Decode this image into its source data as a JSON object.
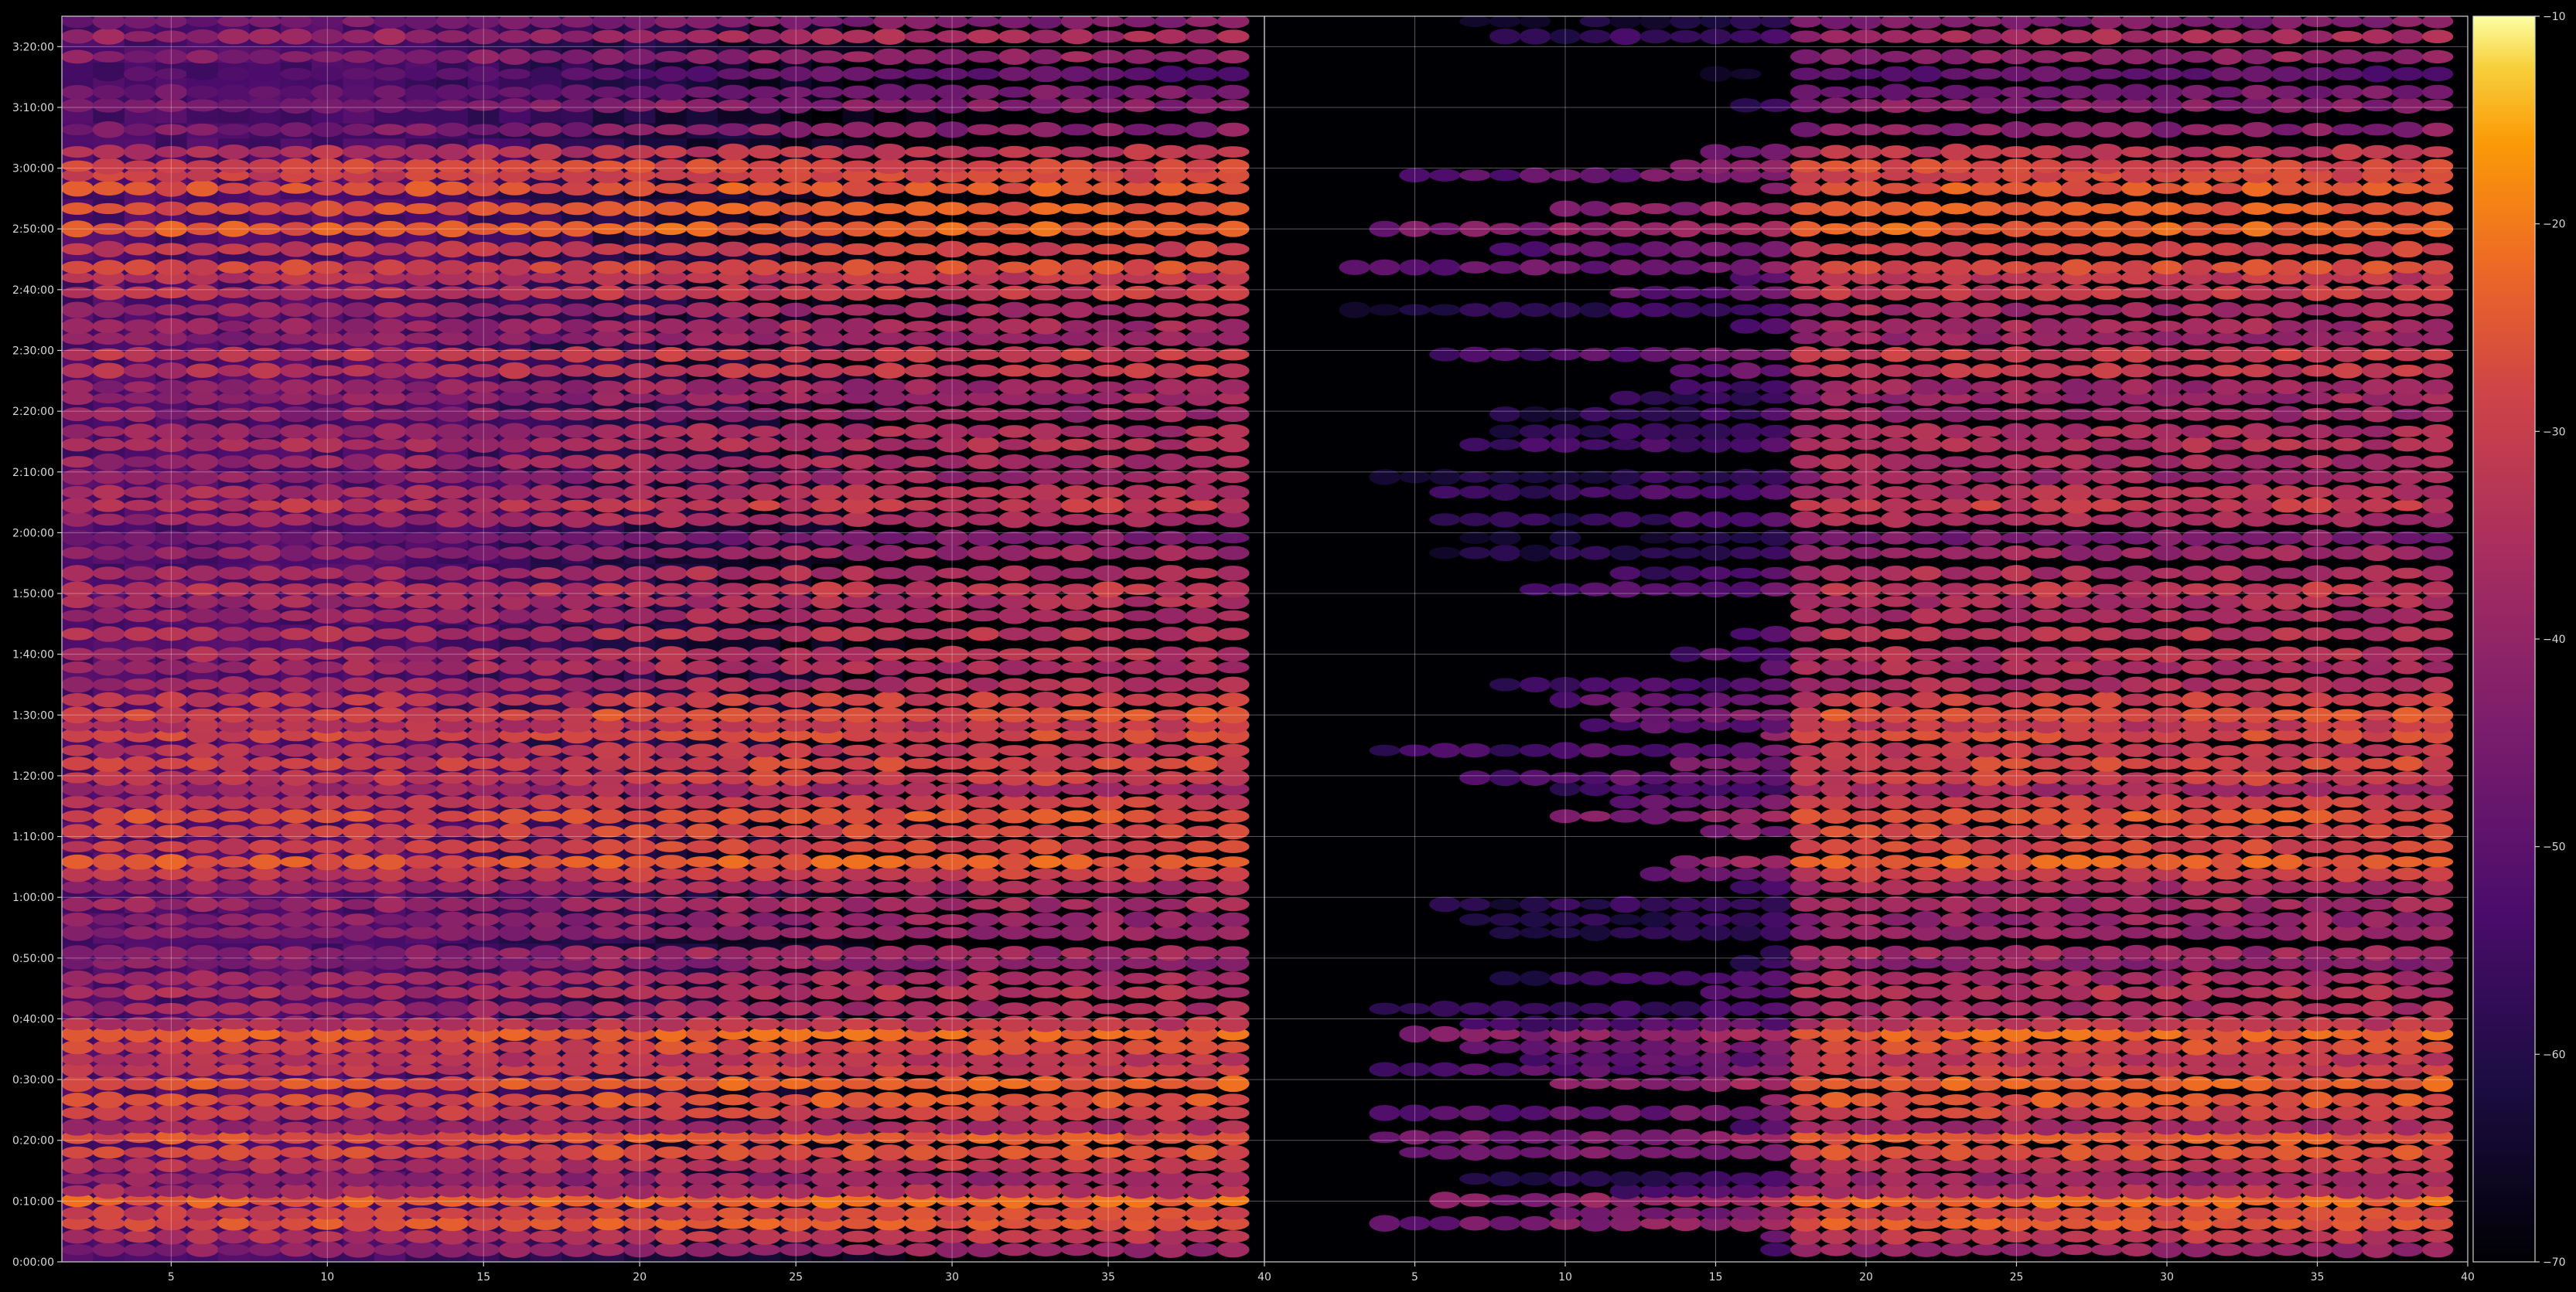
{
  "chart_data": {
    "type": "heatmap",
    "title": "",
    "xlabel": "",
    "ylabel": "",
    "colormap": "inferno",
    "colorbar": {
      "range": [
        -70,
        -10
      ],
      "ticks": [
        -70,
        -60,
        -50,
        -40,
        -30,
        -20,
        -10
      ],
      "tick_labels": [
        "−70",
        "−60",
        "−50",
        "−40",
        "−30",
        "−20",
        "−10"
      ]
    },
    "grid": true,
    "y_axis": {
      "range_seconds": [
        0,
        12300
      ],
      "tick_seconds": [
        0,
        600,
        1200,
        1800,
        2400,
        3000,
        3600,
        4200,
        4800,
        5400,
        6000,
        6600,
        7200,
        7800,
        8400,
        9000,
        9600,
        10200,
        10800,
        11400,
        12000
      ],
      "tick_labels": [
        "0:00:00",
        "0:10:00",
        "0:20:00",
        "0:30:00",
        "0:40:00",
        "0:50:00",
        "1:00:00",
        "1:10:00",
        "1:20:00",
        "1:30:00",
        "1:40:00",
        "1:50:00",
        "2:00:00",
        "2:10:00",
        "2:20:00",
        "2:30:00",
        "2:40:00",
        "2:50:00",
        "3:00:00",
        "3:10:00",
        "3:20:00"
      ]
    },
    "panels": [
      {
        "id": "left",
        "x_range": [
          1.5,
          40
        ],
        "x_ticks": [
          5,
          10,
          15,
          20,
          25,
          30,
          35,
          40
        ],
        "x_tick_labels": [
          "5",
          "10",
          "15",
          "20",
          "25",
          "30",
          "35",
          "40"
        ],
        "columns": [
          2,
          39
        ],
        "floor_db": -52,
        "active_from": 2,
        "active_to": 39
      },
      {
        "id": "right",
        "x_range": [
          0,
          40
        ],
        "x_ticks": [
          5,
          10,
          15,
          20,
          25,
          30,
          35,
          40
        ],
        "x_tick_labels": [
          "5",
          "10",
          "15",
          "20",
          "25",
          "30",
          "35",
          "40"
        ],
        "columns": [
          1,
          39
        ],
        "floor_db": -70,
        "active_from": 18,
        "active_to": 39
      }
    ],
    "bands": [
      {
        "t": 120,
        "db": -45
      },
      {
        "t": 250,
        "db": -38
      },
      {
        "t": 380,
        "db": -30
      },
      {
        "t": 480,
        "db": -34
      },
      {
        "t": 610,
        "db": -27
      },
      {
        "t": 700,
        "db": -40
      },
      {
        "t": 820,
        "db": -44
      },
      {
        "t": 950,
        "db": -38
      },
      {
        "t": 1080,
        "db": -32
      },
      {
        "t": 1230,
        "db": -30
      },
      {
        "t": 1330,
        "db": -42
      },
      {
        "t": 1470,
        "db": -35
      },
      {
        "t": 1600,
        "db": -31
      },
      {
        "t": 1760,
        "db": -29
      },
      {
        "t": 1900,
        "db": -36
      },
      {
        "t": 2000,
        "db": -38
      },
      {
        "t": 2120,
        "db": -33
      },
      {
        "t": 2250,
        "db": -28
      },
      {
        "t": 2350,
        "db": -38
      },
      {
        "t": 2500,
        "db": -42
      },
      {
        "t": 2660,
        "db": -40
      },
      {
        "t": 2800,
        "db": -42
      },
      {
        "t": 2950,
        "db": -46
      },
      {
        "t": 3050,
        "db": -44
      },
      {
        "t": 3250,
        "db": -45
      },
      {
        "t": 3380,
        "db": -45
      },
      {
        "t": 3530,
        "db": -43
      },
      {
        "t": 3700,
        "db": -42
      },
      {
        "t": 3830,
        "db": -36
      },
      {
        "t": 3950,
        "db": -29
      },
      {
        "t": 4100,
        "db": -34
      },
      {
        "t": 4250,
        "db": -34
      },
      {
        "t": 4400,
        "db": -31
      },
      {
        "t": 4540,
        "db": -36
      },
      {
        "t": 4670,
        "db": -42
      },
      {
        "t": 4780,
        "db": -36
      },
      {
        "t": 4920,
        "db": -34
      },
      {
        "t": 5050,
        "db": -38
      },
      {
        "t": 5200,
        "db": -33
      },
      {
        "t": 5300,
        "db": -38
      },
      {
        "t": 5400,
        "db": -32
      },
      {
        "t": 5550,
        "db": -36
      },
      {
        "t": 5700,
        "db": -41
      },
      {
        "t": 5870,
        "db": -41
      },
      {
        "t": 6000,
        "db": -40
      },
      {
        "t": 6200,
        "db": -39
      },
      {
        "t": 6380,
        "db": -42
      },
      {
        "t": 6520,
        "db": -41
      },
      {
        "t": 6640,
        "db": -38
      },
      {
        "t": 6800,
        "db": -41
      },
      {
        "t": 7000,
        "db": -44
      },
      {
        "t": 7150,
        "db": -49
      },
      {
        "t": 7330,
        "db": -42
      },
      {
        "t": 7470,
        "db": -37
      },
      {
        "t": 7600,
        "db": -40
      },
      {
        "t": 7750,
        "db": -44
      },
      {
        "t": 7900,
        "db": -42
      },
      {
        "t": 8070,
        "db": -40
      },
      {
        "t": 8200,
        "db": -42
      },
      {
        "t": 8370,
        "db": -44
      },
      {
        "t": 8530,
        "db": -44
      },
      {
        "t": 8640,
        "db": -44
      },
      {
        "t": 8800,
        "db": -38
      },
      {
        "t": 8960,
        "db": -37
      },
      {
        "t": 9120,
        "db": -45
      },
      {
        "t": 9240,
        "db": -43
      },
      {
        "t": 9400,
        "db": -43
      },
      {
        "t": 9570,
        "db": -37
      },
      {
        "t": 9720,
        "db": -38
      },
      {
        "t": 9820,
        "db": -33
      },
      {
        "t": 10000,
        "db": -35
      },
      {
        "t": 10200,
        "db": -28
      },
      {
        "t": 10400,
        "db": -30
      },
      {
        "t": 10600,
        "db": -30
      },
      {
        "t": 10730,
        "db": -34
      },
      {
        "t": 10820,
        "db": -33
      },
      {
        "t": 10960,
        "db": -38
      },
      {
        "t": 11180,
        "db": -47
      },
      {
        "t": 11420,
        "db": -47
      },
      {
        "t": 11550,
        "db": -50
      },
      {
        "t": 11730,
        "db": -54
      },
      {
        "t": 11900,
        "db": -45
      },
      {
        "t": 12100,
        "db": -42
      },
      {
        "t": 12250,
        "db": -48
      }
    ]
  }
}
